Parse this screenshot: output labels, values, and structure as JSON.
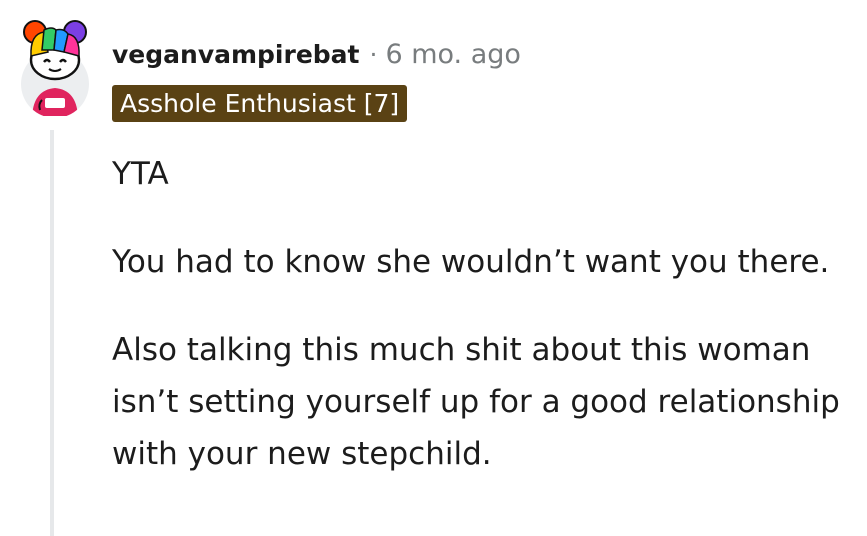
{
  "comment": {
    "author": "veganvampirebat",
    "separator": "·",
    "timestamp": "6 mo. ago",
    "flair": "Asshole Enthusiast [7]",
    "paragraphs": [
      "YTA",
      "You had to know she wouldn’t want you there.",
      "Also talking this much shit about this woman isn’t setting yourself up for a good relationship with your new stepchild."
    ]
  },
  "icons": {
    "avatar": "snoo-avatar-rainbow-hair"
  },
  "colors": {
    "flair_background": "#5a4214",
    "flair_text": "#ffffff",
    "meta_text": "#787c7e",
    "thread_line": "#e6e8ea",
    "avatar_shirt": "#e0245e"
  }
}
